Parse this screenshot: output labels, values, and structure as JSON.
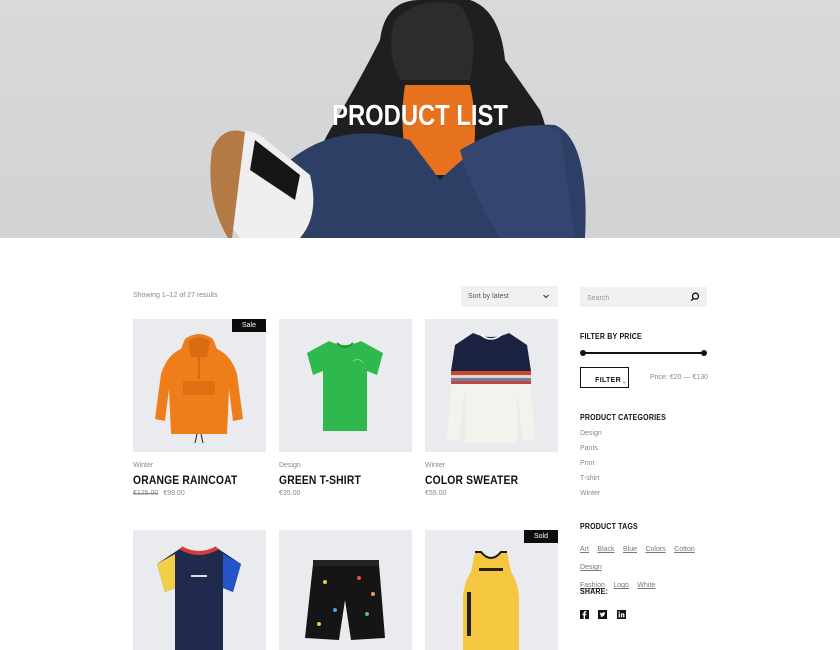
{
  "hero": {
    "title": "PRODUCT LIST"
  },
  "toolbar": {
    "results_text": "Showing 1–12 of 27 results",
    "sort_label": "Sort by latest"
  },
  "products": [
    {
      "category": "Winter",
      "name": "ORANGE RAINCOAT",
      "old_price": "€125.00",
      "price": "€99.00",
      "badge": "Sale",
      "image": "orange-raincoat"
    },
    {
      "category": "Design",
      "name": "GREEN T-SHIRT",
      "old_price": "",
      "price": "€35.00",
      "badge": "",
      "image": "green-tshirt"
    },
    {
      "category": "Winter",
      "name": "COLOR SWEATER",
      "old_price": "",
      "price": "€59.00",
      "badge": "",
      "image": "color-sweater"
    },
    {
      "category": "",
      "name": "",
      "old_price": "",
      "price": "",
      "badge": "",
      "image": "colorblock-tshirt"
    },
    {
      "category": "",
      "name": "",
      "old_price": "",
      "price": "",
      "badge": "",
      "image": "print-shorts"
    },
    {
      "category": "",
      "name": "",
      "old_price": "",
      "price": "",
      "badge": "Sold",
      "image": "yellow-tank-top"
    }
  ],
  "sidebar": {
    "search_placeholder": "Search",
    "filter_price_title": "FILTER BY PRICE",
    "filter_button": "FILTER",
    "price_range": "Price: €20 — €130",
    "categories_title": "PRODUCT CATEGORIES",
    "categories": [
      "Design",
      "Pants",
      "Print",
      "T-shirt",
      "Winter"
    ],
    "tags_title": "PRODUCT TAGS",
    "tags": [
      "Art",
      "Black",
      "Blue",
      "Colors",
      "Cotton",
      "Design",
      "Fashion",
      "Logo",
      "White"
    ],
    "share_title": "SHARE:",
    "share_icons": [
      "facebook-icon",
      "twitter-icon",
      "linkedin-icon"
    ]
  },
  "colors": {
    "accent": "#111111",
    "hero_bg": "#d6d7d8",
    "card_bg": "#e9ebee"
  }
}
